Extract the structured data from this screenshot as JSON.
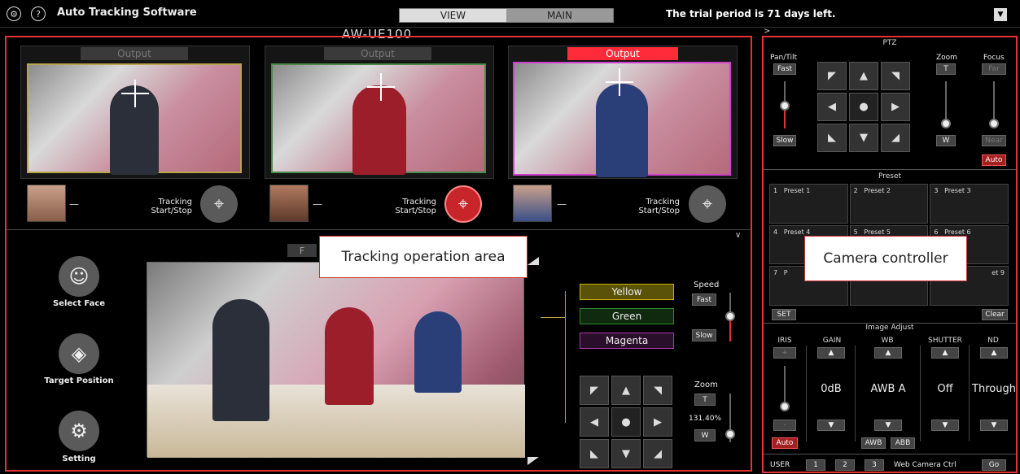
{
  "header": {
    "settings_icon": "gear-icon",
    "help_icon": "help-icon",
    "title": "Auto Tracking Software",
    "tabs": [
      "VIEW",
      "MAIN"
    ],
    "trial": "The trial period is 71 days left."
  },
  "camera": {
    "name": "AW-UE100"
  },
  "outputs": [
    {
      "label": "Output",
      "active": false,
      "face_dash": "—",
      "tracking": "Tracking\nStart/Stop",
      "tracking_on": false
    },
    {
      "label": "Output",
      "active": false,
      "face_dash": "—",
      "tracking": "Tracking\nStart/Stop",
      "tracking_on": true
    },
    {
      "label": "Output",
      "active": true,
      "face_dash": "—",
      "tracking": "Tracking\nStart/Stop",
      "tracking_on": false
    }
  ],
  "tracking_area": {
    "callout": "Tracking operation area",
    "select_face": "Select Face",
    "target_position": "Target Position",
    "setting": "Setting",
    "colors": [
      "Yellow",
      "Green",
      "Magenta"
    ],
    "speed_label": "Speed",
    "fast": "Fast",
    "slow": "Slow",
    "zoom_label": "Zoom",
    "zoom_t": "T",
    "zoom_value": "131.40%",
    "zoom_w": "W",
    "tab_letter": "F"
  },
  "controller": {
    "callout": "Camera controller",
    "ptz_title": "PTZ",
    "pan_tilt": "Pan/Tilt",
    "fast": "Fast",
    "slow": "Slow",
    "zoom": "Zoom",
    "zoom_t": "T",
    "zoom_w": "W",
    "focus": "Focus",
    "far": "Far",
    "near": "Near",
    "auto": "Auto",
    "preset_title": "Preset",
    "presets": [
      {
        "num": "1",
        "name": "Preset 1"
      },
      {
        "num": "2",
        "name": "Preset 2"
      },
      {
        "num": "3",
        "name": "Preset 3"
      },
      {
        "num": "4",
        "name": "Preset 4"
      },
      {
        "num": "5",
        "name": "Preset 5"
      },
      {
        "num": "6",
        "name": "Preset 6"
      },
      {
        "num": "7",
        "name": "P"
      },
      {
        "num": "",
        "name": ""
      },
      {
        "num": "",
        "name": "et 9"
      }
    ],
    "set": "SET",
    "clear": "Clear",
    "image_adjust": "Image Adjust",
    "iris": "IRIS",
    "gain": "GAIN",
    "wb": "WB",
    "shutter": "SHUTTER",
    "nd": "ND",
    "gain_value": "0dB",
    "wb_value": "AWB A",
    "shutter_value": "Off",
    "nd_value": "Through",
    "iris_plus": "+",
    "iris_minus": "-",
    "iris_auto": "Auto",
    "awb": "AWB",
    "abb": "ABB",
    "user": "USER",
    "user_buttons": [
      "1",
      "2",
      "3"
    ],
    "web_ctrl": "Web Camera Ctrl",
    "go": "Go"
  },
  "colors": {
    "red": "#e53333",
    "yellow": "#c8b400",
    "green": "#2e8b2e",
    "magenta": "#b03ab0",
    "output_on": "#ff2a3a"
  }
}
